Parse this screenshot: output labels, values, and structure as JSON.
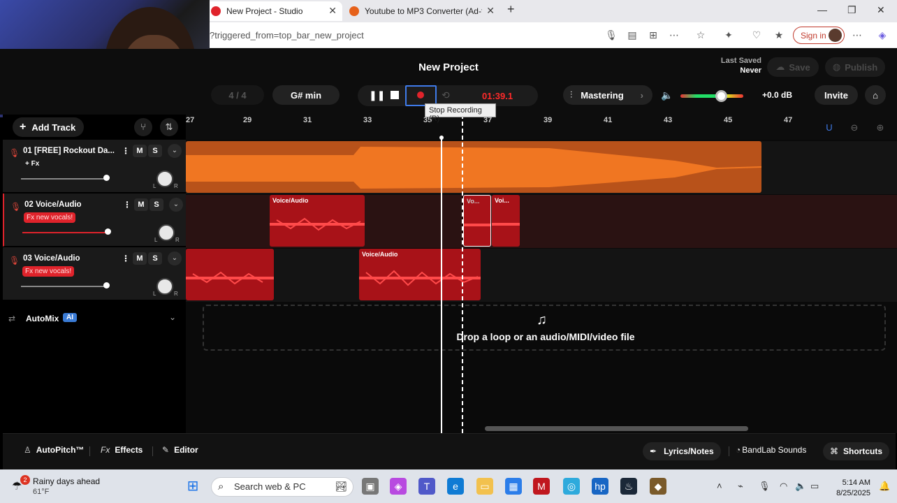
{
  "browser": {
    "tabs": [
      {
        "label": "New Project - Studio",
        "active": true,
        "icon": "bandlab-icon",
        "color": "#e0232b"
      },
      {
        "label": "Youtube to MP3 Converter (Ad-fr",
        "active": false,
        "icon": "converter-icon",
        "color": "#e6611a"
      }
    ],
    "url": "?triggered_from=top_bar_new_project",
    "signin_label": "Sign in"
  },
  "header": {
    "title": "New Project",
    "last_saved_label": "Last Saved",
    "last_saved_value": "Never",
    "save_label": "Save",
    "publish_label": "Publish",
    "time_signature": "4 / 4",
    "key": "G# min",
    "time": "01:39.1",
    "mastering_label": "Mastering",
    "volume_db": "+0.0 dB",
    "volume_level": 0.66,
    "invite_label": "Invite",
    "tooltip": "Stop Recording (R)"
  },
  "sidebar": {
    "add_track_label": "Add Track",
    "tracks": [
      {
        "name": "01  [FREE] Rockout Da...",
        "tag": "+ Fx",
        "tag_style": "plain",
        "fader": 0.98
      },
      {
        "name": "02  Voice/Audio",
        "tag": "Fx new vocals!",
        "tag_style": "red",
        "fader": 0.98
      },
      {
        "name": "03  Voice/Audio",
        "tag": "Fx new vocals!",
        "tag_style": "red",
        "fader": 0.98
      }
    ],
    "mute_label": "M",
    "solo_label": "S",
    "pan_left": "L",
    "pan_right": "R",
    "automix_label": "AutoMix",
    "automix_badge": "AI"
  },
  "timeline": {
    "bars": [
      "27",
      "29",
      "31",
      "33",
      "35",
      "37",
      "39",
      "41",
      "43",
      "45",
      "47"
    ],
    "clips": [
      {
        "lane": 1,
        "label": "Voice/Audio"
      },
      {
        "lane": 1,
        "label": "Vo..."
      },
      {
        "lane": 1,
        "label": "Voi..."
      },
      {
        "lane": 2,
        "label": ""
      },
      {
        "lane": 2,
        "label": "Voice/Audio"
      }
    ],
    "drop_text": "Drop a loop or an audio/MIDI/video file"
  },
  "bottombar": {
    "autopitch_label": "AutoPitch™",
    "effects_label": "Effects",
    "editor_label": "Editor",
    "lyrics_label": "Lyrics/Notes",
    "sounds_label": "BandLab Sounds",
    "shortcuts_label": "Shortcuts"
  },
  "taskbar": {
    "weather_title": "Rainy days ahead",
    "weather_temp": "61°F",
    "weather_badge": "2",
    "search_placeholder": "Search web & PC",
    "time": "5:14 AM",
    "date": "8/25/2025"
  },
  "colors": {
    "accent_red": "#e0232b",
    "orange_clip": "#e8671c",
    "red_clip": "#b3141b"
  }
}
